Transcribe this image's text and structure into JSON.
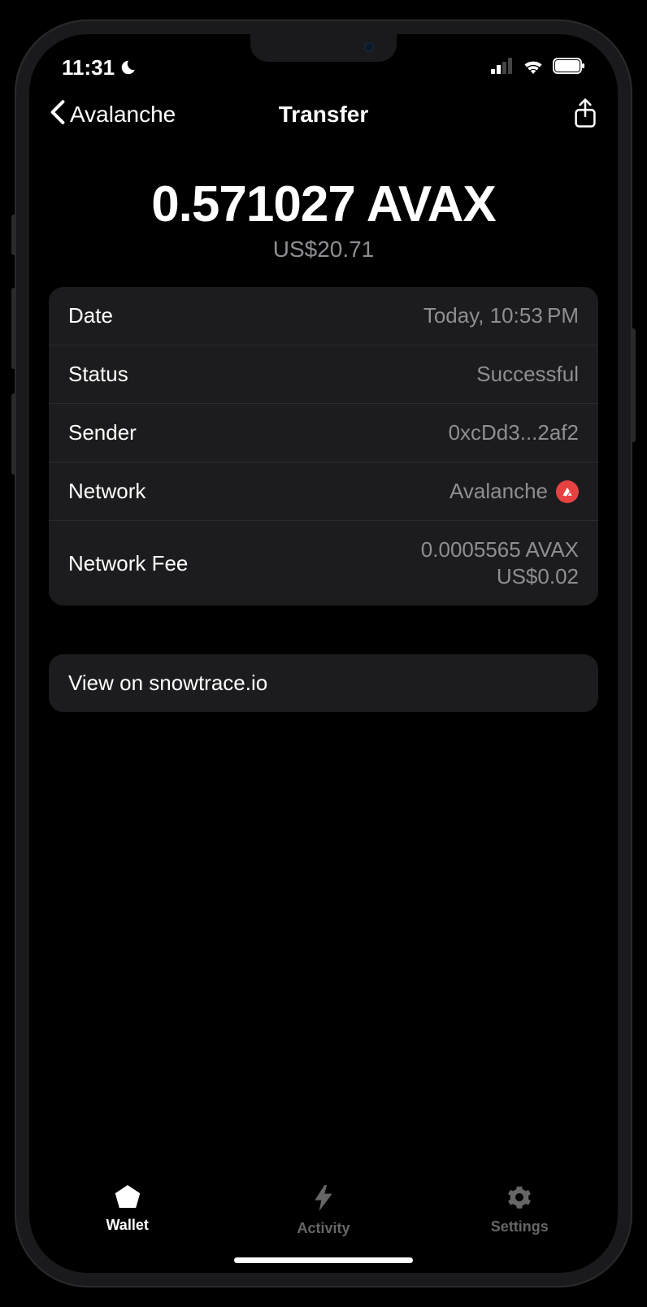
{
  "statusBar": {
    "time": "11:31"
  },
  "nav": {
    "backLabel": "Avalanche",
    "title": "Transfer"
  },
  "amount": {
    "main": "0.571027 AVAX",
    "fiat": "US$20.71"
  },
  "details": {
    "dateLabel": "Date",
    "dateValue": "Today, 10:53 PM",
    "statusLabel": "Status",
    "statusValue": "Successful",
    "senderLabel": "Sender",
    "senderValue": "0xcDd3...2af2",
    "networkLabel": "Network",
    "networkValue": "Avalanche",
    "feeLabel": "Network Fee",
    "feeCrypto": "0.0005565 AVAX",
    "feeFiat": "US$0.02"
  },
  "explorer": {
    "label": "View on snowtrace.io"
  },
  "tabs": {
    "wallet": "Wallet",
    "activity": "Activity",
    "settings": "Settings"
  }
}
